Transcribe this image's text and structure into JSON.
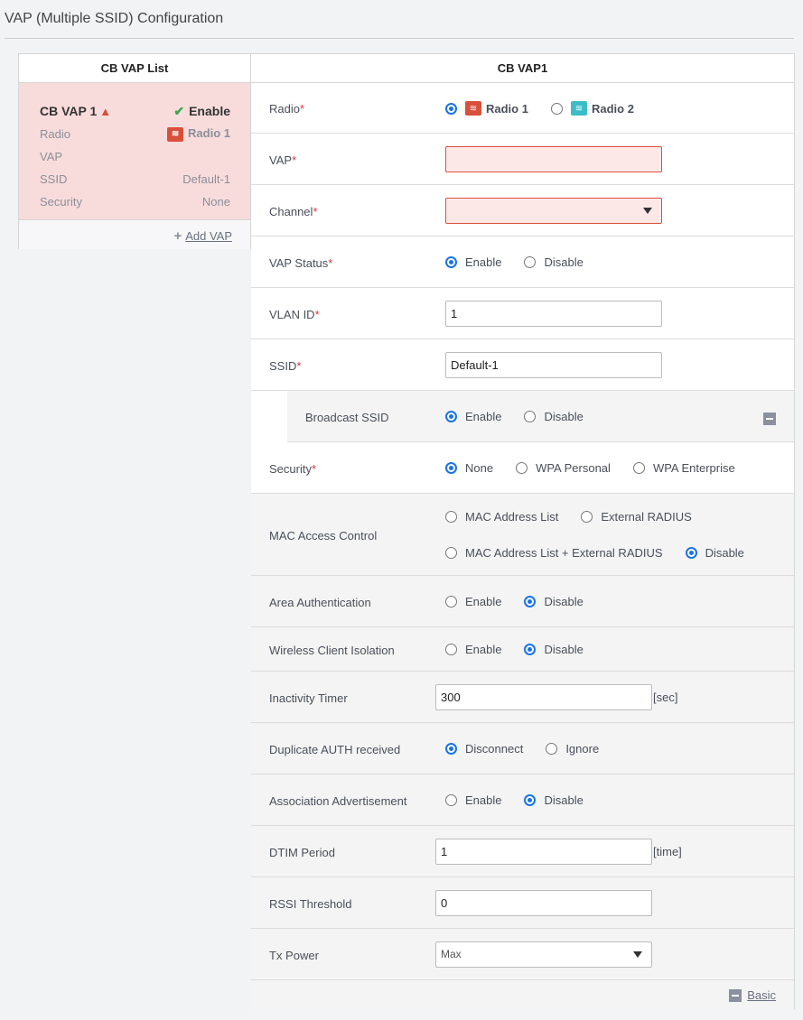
{
  "page": {
    "title": "VAP (Multiple SSID) Configuration"
  },
  "list": {
    "header": "CB VAP List",
    "card": {
      "name": "CB VAP 1",
      "status": "Enable",
      "rows": [
        {
          "label": "Radio",
          "value": "Radio 1"
        },
        {
          "label": "VAP",
          "value": ""
        },
        {
          "label": "SSID",
          "value": "Default-1"
        },
        {
          "label": "Security",
          "value": "None"
        }
      ]
    },
    "add_label": "Add VAP"
  },
  "panel": {
    "header": "CB VAP1",
    "basic_label": "Basic"
  },
  "rows": [
    {
      "label": "Radio",
      "req": true,
      "type": "radio",
      "bold": true,
      "options": [
        {
          "t": "Radio 1",
          "on": true,
          "icon": "w1"
        },
        {
          "t": "Radio 2",
          "on": false,
          "icon": "w2"
        }
      ]
    },
    {
      "label": "VAP",
      "req": true,
      "type": "input",
      "value": "",
      "err": true
    },
    {
      "label": "Channel",
      "req": true,
      "type": "select",
      "value": "",
      "err": true
    },
    {
      "label": "VAP Status",
      "req": true,
      "type": "radio",
      "options": [
        {
          "t": "Enable",
          "on": true
        },
        {
          "t": "Disable",
          "on": false
        }
      ]
    },
    {
      "label": "VLAN ID",
      "req": true,
      "type": "input",
      "value": "1"
    },
    {
      "label": "SSID",
      "req": true,
      "type": "input",
      "value": "Default-1"
    },
    {
      "label": "Broadcast SSID",
      "type": "radio",
      "sub": true,
      "options": [
        {
          "t": "Enable",
          "on": true
        },
        {
          "t": "Disable",
          "on": false
        }
      ]
    },
    {
      "label": "Security",
      "req": true,
      "type": "radio",
      "options": [
        {
          "t": "None",
          "on": true
        },
        {
          "t": "WPA Personal",
          "on": false
        },
        {
          "t": "WPA Enterprise",
          "on": false
        }
      ]
    },
    {
      "label": "MAC Access Control",
      "type": "radio2",
      "options": [
        {
          "t": "MAC Address List",
          "on": false
        },
        {
          "t": "External RADIUS",
          "on": false
        },
        {
          "t": "MAC Address List + External RADIUS",
          "on": false
        },
        {
          "t": "Disable",
          "on": true
        }
      ]
    },
    {
      "label": "Area Authentication",
      "type": "radio",
      "options": [
        {
          "t": "Enable",
          "on": false
        },
        {
          "t": "Disable",
          "on": true
        }
      ]
    },
    {
      "label": "Wireless Client Isolation",
      "type": "radio",
      "options": [
        {
          "t": "Enable",
          "on": false
        },
        {
          "t": "Disable",
          "on": true
        }
      ]
    },
    {
      "label": "Inactivity Timer",
      "type": "input",
      "value": "300",
      "unit": "[sec]"
    },
    {
      "label": "Duplicate AUTH received",
      "type": "radio",
      "options": [
        {
          "t": "Disconnect",
          "on": true
        },
        {
          "t": "Ignore",
          "on": false
        }
      ]
    },
    {
      "label": "Association Advertisement",
      "type": "radio",
      "options": [
        {
          "t": "Enable",
          "on": false
        },
        {
          "t": "Disable",
          "on": true
        }
      ]
    },
    {
      "label": "DTIM Period",
      "type": "input",
      "value": "1",
      "unit": "[time]"
    },
    {
      "label": "RSSI Threshold",
      "type": "input",
      "value": "0"
    },
    {
      "label": "Tx Power",
      "type": "select",
      "value": "Max"
    }
  ]
}
